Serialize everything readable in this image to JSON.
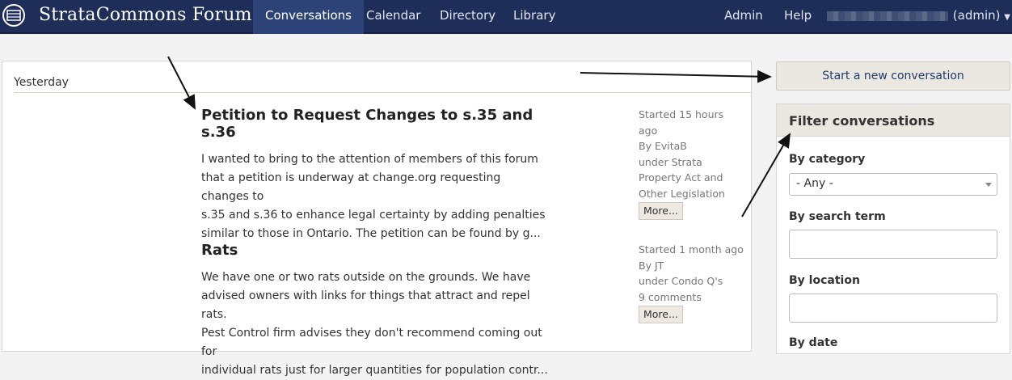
{
  "header": {
    "brand": "StrataCommons Forum",
    "nav": [
      "Conversations",
      "Calendar",
      "Directory",
      "Library"
    ],
    "right_nav": [
      "Admin",
      "Help"
    ],
    "user_suffix": "(admin)"
  },
  "main": {
    "group_label": "Yesterday",
    "conversations": [
      {
        "title": "Petition to Request Changes to s.35 and s.36",
        "lines": [
          "I wanted to bring to the attention of members of this forum",
          "that a petition is underway at change.org requesting changes to",
          "s.35 and s.36 to enhance legal certainty by adding penalties",
          "similar to those in Ontario. The petition can be found by g..."
        ],
        "meta": [
          "Started 15 hours ago",
          "By EvitaB",
          "under Strata",
          "Property Act and",
          "Other Legislation"
        ],
        "more": "More..."
      },
      {
        "title": "Rats",
        "lines": [
          "We have one or two rats outside on the grounds. We have",
          "advised owners with links for things that attract and repel rats.",
          "Pest Control firm advises they don't recommend coming out for",
          "individual rats just for larger quantities for population contr..."
        ],
        "meta": [
          "Started 1 month ago",
          "By JT",
          "under Condo Q's",
          "9 comments"
        ],
        "more": "More..."
      }
    ]
  },
  "sidebar": {
    "new_button": "Start a new conversation",
    "filter_title": "Filter conversations",
    "by_category": "By category",
    "category_value": "- Any -",
    "by_search": "By search term",
    "by_location": "By location",
    "by_date": "By date"
  }
}
